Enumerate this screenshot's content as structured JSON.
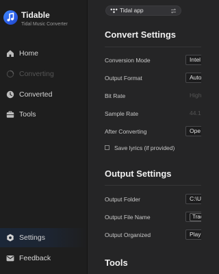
{
  "app": {
    "name": "Tidable",
    "subtitle": "Tidal Music Converter",
    "accent": "#3f8cff"
  },
  "sidebar": {
    "items": [
      {
        "label": "Home",
        "icon": "home-icon",
        "state": "normal"
      },
      {
        "label": "Converting",
        "icon": "converting-icon",
        "state": "disabled"
      },
      {
        "label": "Converted",
        "icon": "clock-icon",
        "state": "normal"
      },
      {
        "label": "Tools",
        "icon": "toolbox-icon",
        "state": "normal"
      }
    ],
    "bottom": [
      {
        "label": "Settings",
        "icon": "gear-icon",
        "state": "active"
      },
      {
        "label": "Feedback",
        "icon": "mail-icon",
        "state": "normal"
      }
    ]
  },
  "source": {
    "label": "Tidal app",
    "icon": "tidal-icon",
    "switch_icon": "swap-icon"
  },
  "convert": {
    "title": "Convert Settings",
    "rows": [
      {
        "label": "Conversion Mode",
        "value": "Intel"
      },
      {
        "label": "Output Format",
        "value": "Auto"
      },
      {
        "label": "Bit Rate",
        "value": "High"
      },
      {
        "label": "Sample Rate",
        "value": "44.1"
      },
      {
        "label": "After Converting",
        "value": "Ope"
      }
    ],
    "save_lyrics": {
      "label": "Save lyrics (if provided)",
      "checked": false
    }
  },
  "output": {
    "title": "Output Settings",
    "rows": [
      {
        "label": "Output Folder",
        "value": "C:\\U"
      },
      {
        "label": "Output File Name",
        "value": "Trac"
      },
      {
        "label": "Output Organized",
        "value": "Play"
      }
    ]
  },
  "tools": {
    "title": "Tools"
  }
}
